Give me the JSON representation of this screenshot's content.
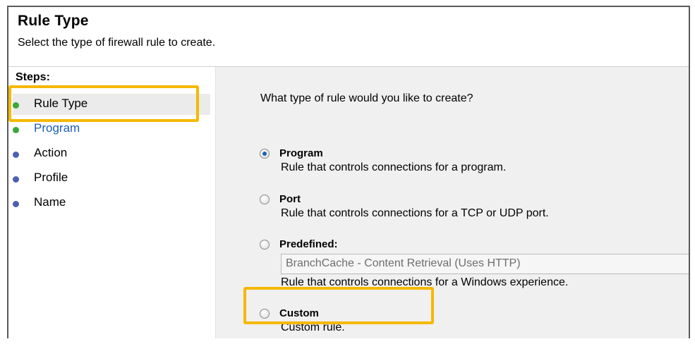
{
  "header": {
    "title": "Rule Type",
    "subtitle": "Select the type of firewall rule to create."
  },
  "steps": {
    "heading": "Steps:",
    "items": [
      {
        "label": "Rule Type",
        "dot_color": "#3aa83a"
      },
      {
        "label": "Program",
        "dot_color": "#3aa83a"
      },
      {
        "label": "Action",
        "dot_color": "#4d5fb0"
      },
      {
        "label": "Profile",
        "dot_color": "#4d5fb0"
      },
      {
        "label": "Name",
        "dot_color": "#4d5fb0"
      }
    ]
  },
  "main": {
    "question": "What type of rule would you like to create?",
    "options": [
      {
        "label": "Program",
        "description": "Rule that controls connections for a program.",
        "selected": true
      },
      {
        "label": "Port",
        "description": "Rule that controls connections for a TCP or UDP port.",
        "selected": false
      },
      {
        "label": "Predefined:",
        "dropdown_value": "BranchCache - Content Retrieval (Uses HTTP)",
        "description": "Rule that controls connections for a Windows experience.",
        "selected": false
      },
      {
        "label": "Custom",
        "description": "Custom rule.",
        "selected": false
      }
    ]
  },
  "colors": {
    "highlight": "#f5b800",
    "link": "#1a5fb4",
    "selected_radio": "#1e5fb8"
  }
}
